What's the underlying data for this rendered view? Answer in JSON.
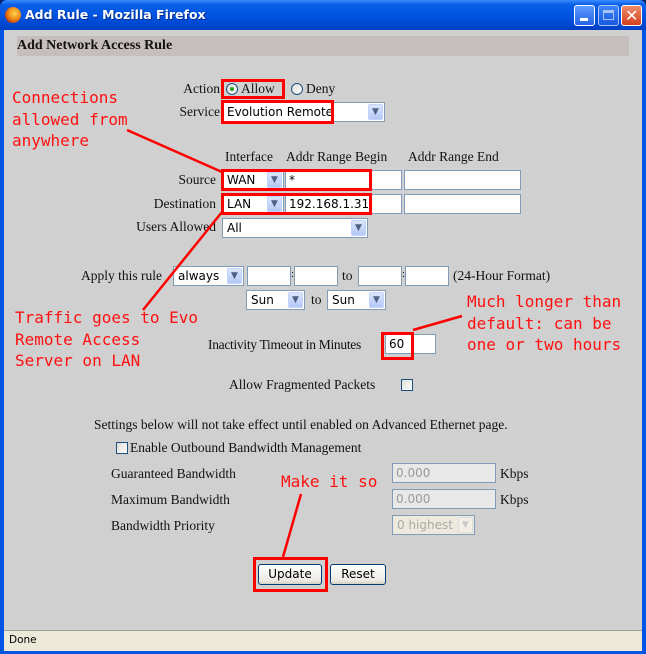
{
  "window": {
    "title": "Add Rule - Mozilla Firefox",
    "icon": "firefox-icon",
    "controls": [
      "minimize-icon",
      "maximize-icon",
      "close-icon"
    ]
  },
  "form": {
    "heading": "Add Network Access Rule",
    "action": {
      "label": "Action",
      "options": [
        "Allow",
        "Deny"
      ],
      "selected": "Allow"
    },
    "service": {
      "label": "Service",
      "value": "Evolution Remote"
    },
    "columns": [
      "Interface",
      "Addr Range Begin",
      "Addr Range End"
    ],
    "source": {
      "label": "Source",
      "interface": "WAN",
      "range_begin": "*",
      "range_end": ""
    },
    "destination": {
      "label": "Destination",
      "interface": "LAN",
      "range_begin": "192.168.1.31",
      "range_end": ""
    },
    "users_allowed": {
      "label": "Users Allowed",
      "value": "All"
    },
    "schedule": {
      "label": "Apply this rule",
      "mode": "always",
      "start_hour": "",
      "start_min": "",
      "to_label": "to",
      "end_hour": "",
      "end_min": "",
      "time_sep": ":",
      "format_note": "(24-Hour Format)",
      "day_from": "Sun",
      "day_to": "Sun"
    },
    "inactivity_timeout": {
      "label": "Inactivity Timeout in Minutes",
      "value": "60"
    },
    "allow_fragmented": {
      "label": "Allow Fragmented Packets",
      "checked": false
    },
    "advanced_note": "Settings below will not take effect until enabled on Advanced Ethernet page.",
    "bandwidth": {
      "enable_label": "Enable Outbound Bandwidth Management",
      "enabled": false,
      "guaranteed_label": "Guaranteed Bandwidth",
      "guaranteed_value": "0.000",
      "maximum_label": "Maximum Bandwidth",
      "maximum_value": "0.000",
      "unit": "Kbps",
      "priority_label": "Bandwidth Priority",
      "priority_value": "0 highest"
    },
    "buttons": {
      "update": "Update",
      "reset": "Reset"
    }
  },
  "annotations": {
    "colors": {
      "highlight": "#ff0000"
    },
    "source_note": "Connections\nallowed from\nanywhere",
    "destination_note": "Traffic goes to Evo\nRemote Access\nServer on LAN",
    "timeout_note": "Much longer than\ndefault: can be\none or two hours",
    "update_note": "Make it so"
  },
  "status_bar": {
    "text": "Done"
  }
}
